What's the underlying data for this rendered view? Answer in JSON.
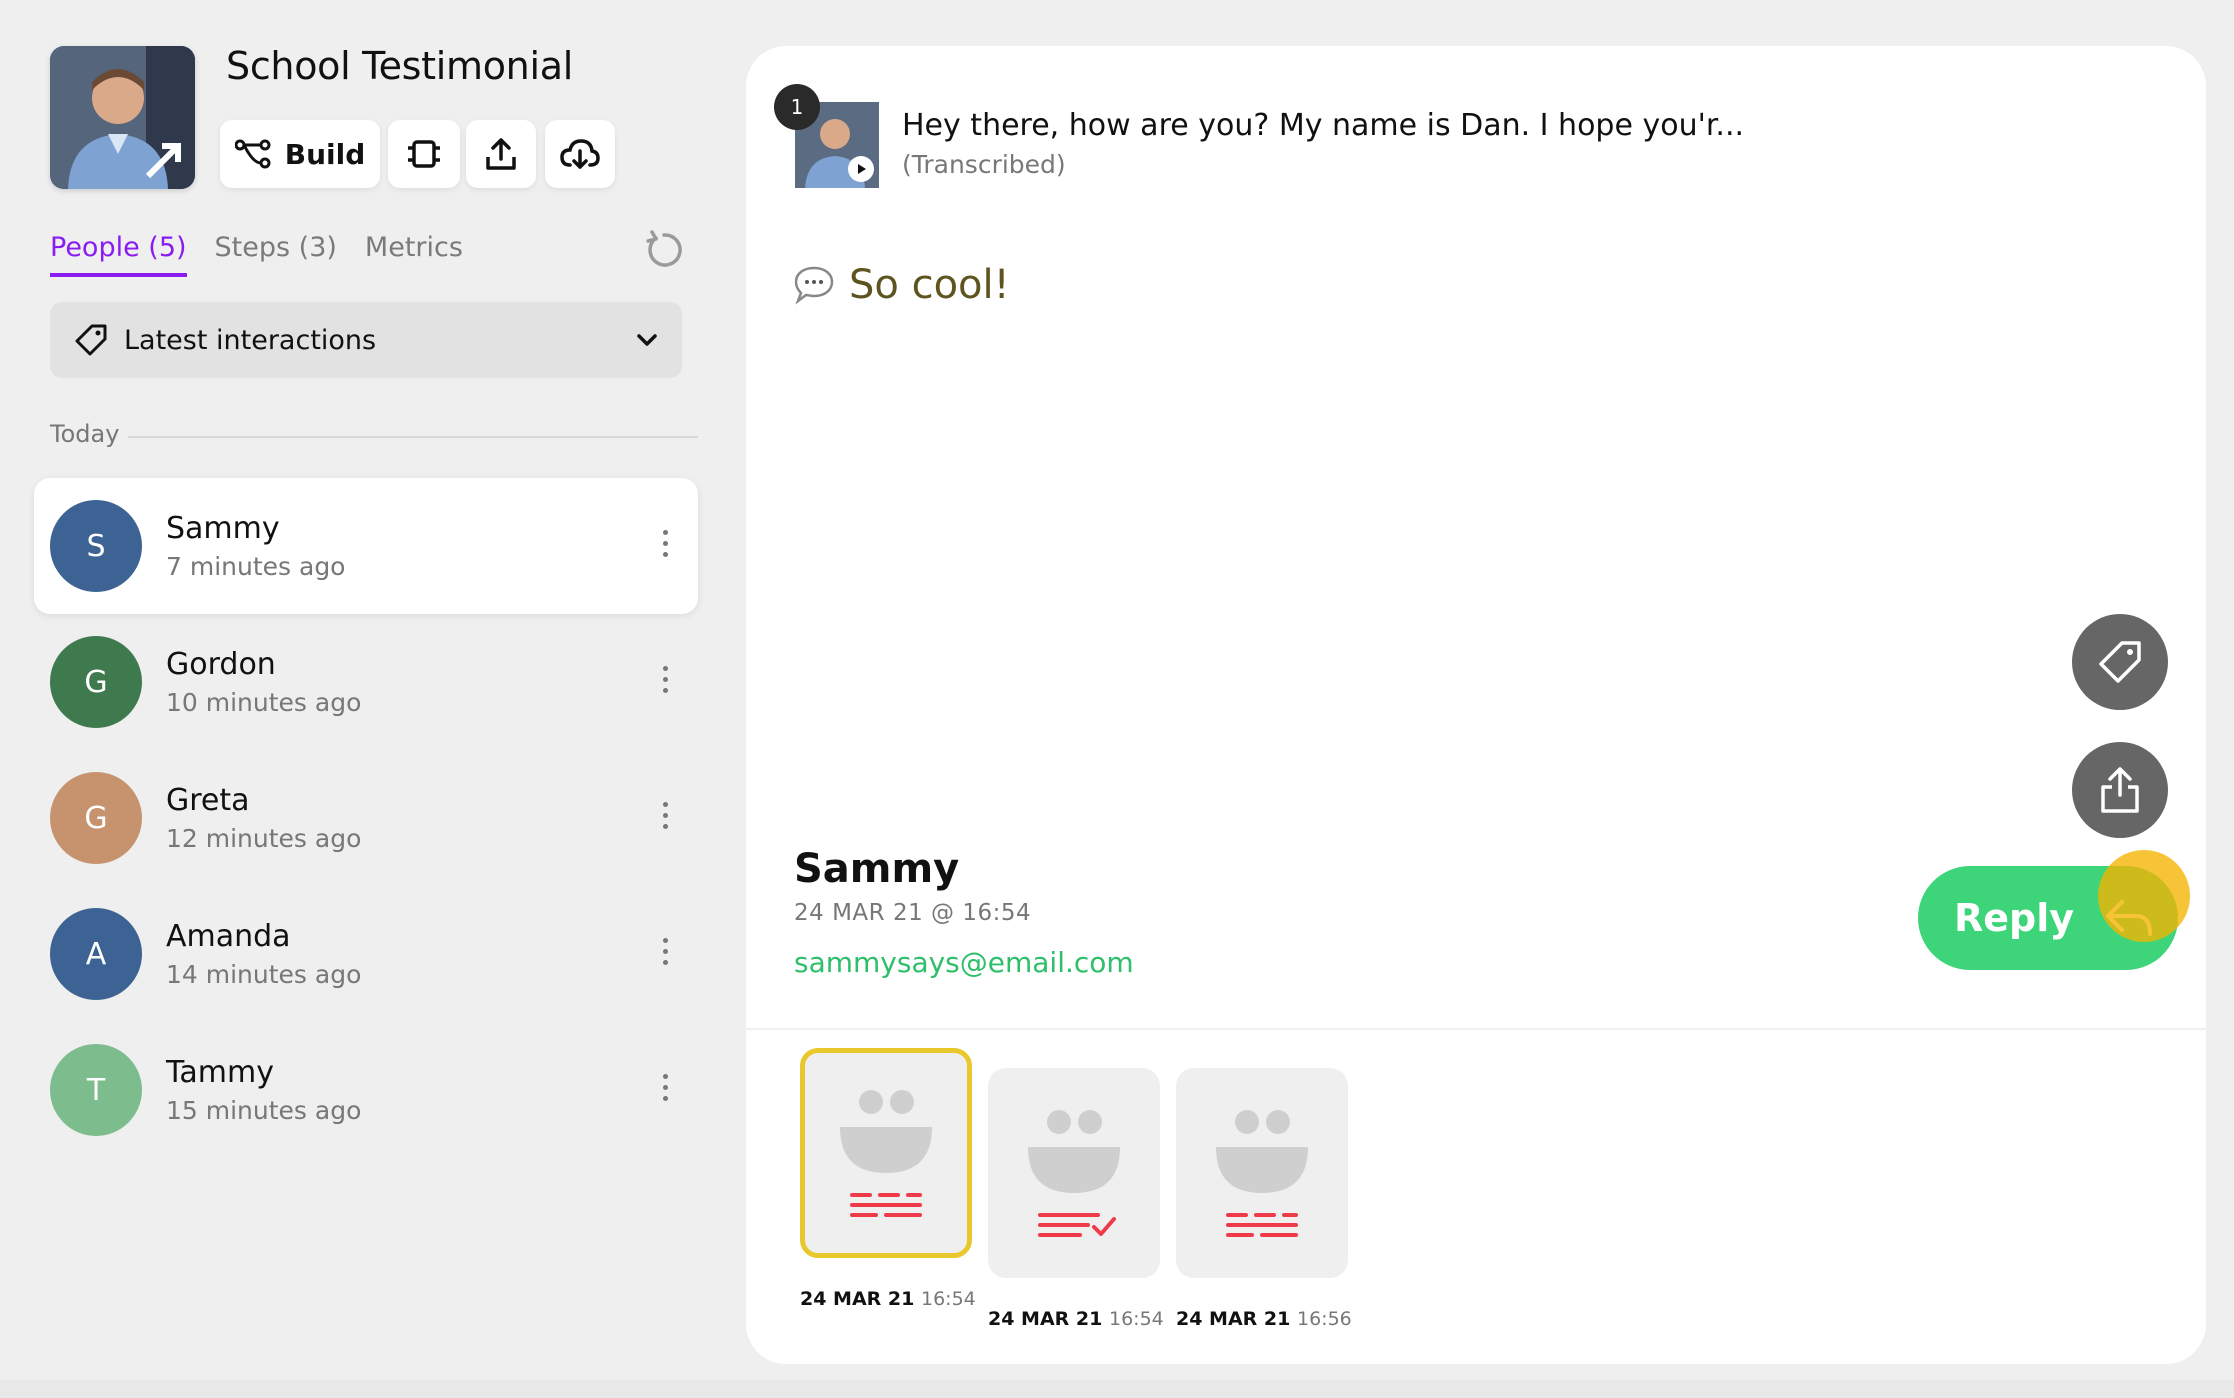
{
  "project": {
    "title": "School Testimonial",
    "build_label": "Build"
  },
  "tabs": [
    {
      "label": "People (5)"
    },
    {
      "label": "Steps (3)"
    },
    {
      "label": "Metrics"
    }
  ],
  "filter": {
    "label": "Latest interactions"
  },
  "section_label": "Today",
  "people": [
    {
      "initial": "S",
      "name": "Sammy",
      "time": "7 minutes ago",
      "color": "#3c6394"
    },
    {
      "initial": "G",
      "name": "Gordon",
      "time": "10 minutes ago",
      "color": "#3f7a4f"
    },
    {
      "initial": "G",
      "name": "Greta",
      "time": "12 minutes ago",
      "color": "#c7936f"
    },
    {
      "initial": "A",
      "name": "Amanda",
      "time": "14 minutes ago",
      "color": "#3c6394"
    },
    {
      "initial": "T",
      "name": "Tammy",
      "time": "15 minutes ago",
      "color": "#7dbd8d"
    }
  ],
  "message": {
    "badge": "1",
    "text": "Hey there, how are you? My name is Dan. I hope you'r...",
    "sub": "(Transcribed)",
    "comment": "So cool!"
  },
  "sender": {
    "name": "Sammy",
    "date": "24 MAR 21 @ 16:54",
    "email": "sammysays@email.com"
  },
  "reply_label": "Reply",
  "responses": [
    {
      "date": "24 MAR 21",
      "time": "16:54"
    },
    {
      "date": "24 MAR 21",
      "time": "16:54"
    },
    {
      "date": "24 MAR 21",
      "time": "16:56"
    }
  ],
  "colors": {
    "accent": "#8a1cf2",
    "reply": "#3dd47a",
    "email": "#2fbf6a",
    "selected_card": "#e8c82c",
    "card_icon": "#ef3a4a"
  }
}
